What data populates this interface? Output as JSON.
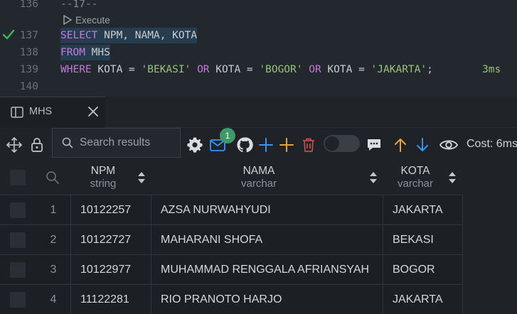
{
  "editor": {
    "codelens_label": "Execute",
    "lines": [
      {
        "n": "136",
        "parts": [
          {
            "t": "--17--",
            "c": "cmt"
          }
        ]
      },
      {
        "n": "137",
        "parts": [
          {
            "t": "SELECT",
            "c": "kw"
          },
          {
            "t": " NPM, NAMA, KOTA",
            "c": ""
          }
        ]
      },
      {
        "n": "138",
        "parts": [
          {
            "t": "FROM",
            "c": "kw"
          },
          {
            "t": " MHS",
            "c": ""
          }
        ]
      },
      {
        "n": "139",
        "parts": [
          {
            "t": "WHERE",
            "c": "kw"
          },
          {
            "t": " KOTA = ",
            "c": ""
          },
          {
            "t": "'BEKASI'",
            "c": "str"
          },
          {
            "t": " ",
            "c": ""
          },
          {
            "t": "OR",
            "c": "kw"
          },
          {
            "t": " KOTA = ",
            "c": ""
          },
          {
            "t": "'BOGOR'",
            "c": "str"
          },
          {
            "t": " ",
            "c": ""
          },
          {
            "t": "OR",
            "c": "kw"
          },
          {
            "t": " KOTA = ",
            "c": ""
          },
          {
            "t": "'JAKARTA'",
            "c": "str"
          },
          {
            "t": ";",
            "c": ""
          }
        ]
      },
      {
        "n": "140",
        "parts": []
      }
    ],
    "timing": "3ms"
  },
  "tab": {
    "label": "MHS"
  },
  "toolbar": {
    "search_placeholder": "Search results",
    "notification_count": "1",
    "cost_label": "Cost: 6ms"
  },
  "grid": {
    "columns": [
      {
        "name": "NPM",
        "type": "string"
      },
      {
        "name": "NAMA",
        "type": "varchar"
      },
      {
        "name": "KOTA",
        "type": "varchar"
      }
    ],
    "rows": [
      {
        "n": "1",
        "npm": "10122257",
        "nama": "AZSA NURWAHYUDI",
        "kota": "JAKARTA"
      },
      {
        "n": "2",
        "npm": "10122727",
        "nama": "MAHARANI SHOFA",
        "kota": "BEKASI"
      },
      {
        "n": "3",
        "npm": "10122977",
        "nama": "MUHAMMAD RENGGALA AFRIANSYAH",
        "kota": "BOGOR"
      },
      {
        "n": "4",
        "npm": "11122281",
        "nama": "RIO PRANOTO HARJO",
        "kota": "JAKARTA"
      }
    ]
  },
  "colors": {
    "accent": "#3794ff",
    "keyword": "#c678dd",
    "string": "#98c379",
    "badge": "#3e9a6a",
    "plus": "#e8a33d",
    "delete": "#c0504d"
  }
}
